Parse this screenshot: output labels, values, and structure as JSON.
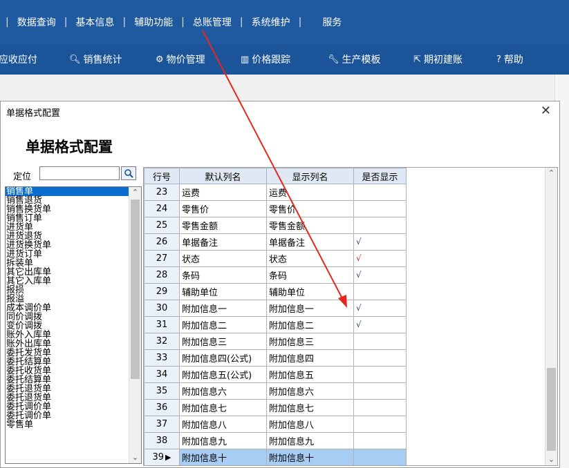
{
  "menu": {
    "items": [
      "数据查询",
      "基本信息",
      "辅助功能",
      "总账管理",
      "系统维护",
      "服务"
    ],
    "separator": "|"
  },
  "toolbar": {
    "items": [
      {
        "icon": "",
        "label": "应收应付"
      },
      {
        "icon": "search-icon",
        "label": "销售统计"
      },
      {
        "icon": "gear-icon",
        "label": "物价管理"
      },
      {
        "icon": "chart-icon",
        "label": "价格跟踪"
      },
      {
        "icon": "wrench-icon",
        "label": "生产模板"
      },
      {
        "icon": "export-icon",
        "label": "期初建账"
      },
      {
        "icon": "help-icon",
        "label": "帮助"
      }
    ]
  },
  "dialog": {
    "title": "单据格式配置",
    "heading": "单据格式配置",
    "locate_label": "定位",
    "locate_value": ""
  },
  "doc_list": {
    "selected": "销售单",
    "items": [
      "销售单",
      "销售退货",
      "销售换货单",
      "销售订单",
      "进货单",
      "进货退货",
      "进货换货单",
      "进货订单",
      "拆装单",
      "其它出库单",
      "其它入库单",
      "报损",
      "报溢",
      "成本调价单",
      "同价调拨",
      "变价调拨",
      "账外入库单",
      "账外出库单",
      "委托发货单",
      "委托结算单",
      "委托收货单",
      "委托结算单",
      "委托退货单",
      "委托退货单",
      "委托调价单",
      "委托调价单",
      "零售单"
    ]
  },
  "grid": {
    "columns": [
      "行号",
      "默认列名",
      "显示列名",
      "是否显示"
    ],
    "rows": [
      {
        "num": "23",
        "default": "运费",
        "display": "运费",
        "show": ""
      },
      {
        "num": "24",
        "default": "零售价",
        "display": "零售价",
        "show": ""
      },
      {
        "num": "25",
        "default": "零售金额",
        "display": "零售金额",
        "show": ""
      },
      {
        "num": "26",
        "default": "单据备注",
        "display": "单据备注",
        "show": "√"
      },
      {
        "num": "27",
        "default": "状态",
        "display": "状态",
        "show": "√",
        "show_color": "red"
      },
      {
        "num": "28",
        "default": "条码",
        "display": "条码",
        "show": "√"
      },
      {
        "num": "29",
        "default": "辅助单位",
        "display": "辅助单位",
        "show": ""
      },
      {
        "num": "30",
        "default": "附加信息一",
        "display": "附加信息一",
        "show": "√"
      },
      {
        "num": "31",
        "default": "附加信息二",
        "display": "附加信息二",
        "show": "√"
      },
      {
        "num": "32",
        "default": "附加信息三",
        "display": "附加信息三",
        "show": ""
      },
      {
        "num": "33",
        "default": "附加信息四(公式)",
        "display": "附加信息四",
        "show": ""
      },
      {
        "num": "34",
        "default": "附加信息五(公式)",
        "display": "附加信息五",
        "show": ""
      },
      {
        "num": "35",
        "default": "附加信息六",
        "display": "附加信息六",
        "show": ""
      },
      {
        "num": "36",
        "default": "附加信息七",
        "display": "附加信息七",
        "show": ""
      },
      {
        "num": "37",
        "default": "附加信息八",
        "display": "附加信息八",
        "show": ""
      },
      {
        "num": "38",
        "default": "附加信息九",
        "display": "附加信息九",
        "show": ""
      },
      {
        "num": "39",
        "default": "附加信息十",
        "display": "附加信息十",
        "show": "",
        "selected": true,
        "indicator": "▶"
      }
    ]
  },
  "colors": {
    "menubar": "#1f5aa0",
    "toolbar": "#1c5499",
    "selection": "#0a6ed1",
    "row_selected": "#a8cdf5",
    "annotation_arrow": "#e8261c"
  }
}
